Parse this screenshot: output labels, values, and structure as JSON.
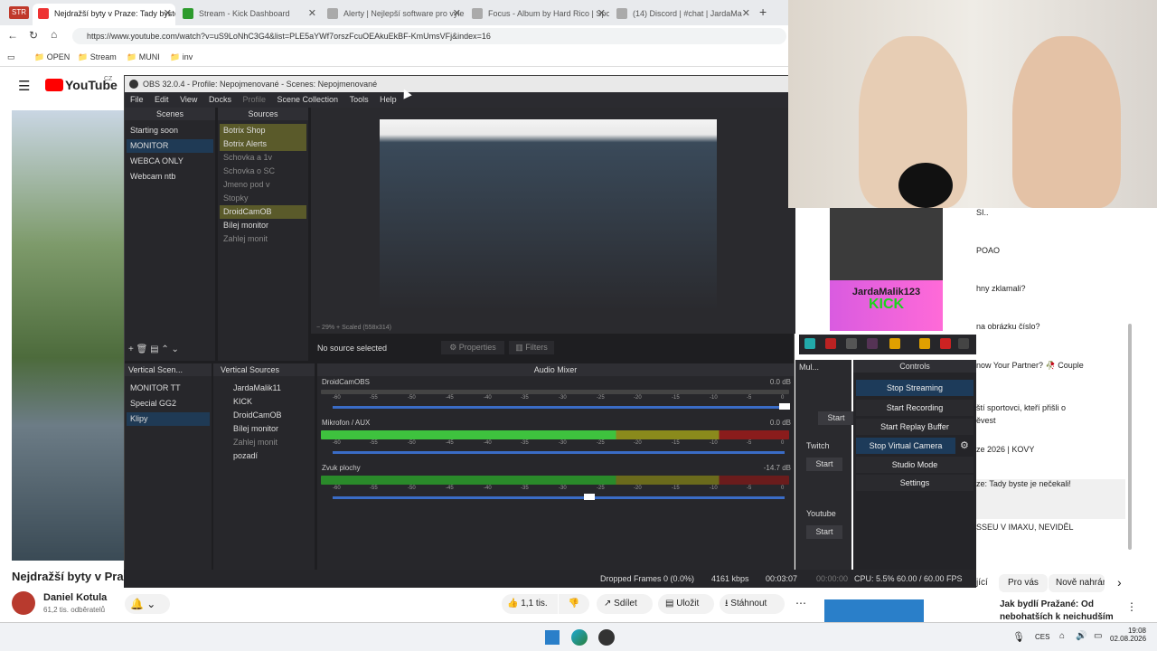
{
  "browser": {
    "str_badge": "STR",
    "tabs": [
      {
        "title": "Nejdražší byty v Praze: Tady byste",
        "fav": "#d33"
      },
      {
        "title": "Stream - Kick Dashboard",
        "fav": "#2d9b2d"
      },
      {
        "title": "Alerty | Nejlepší software pro vylep",
        "fav": "#888"
      },
      {
        "title": "Focus - Album by Hard Rico | Spot",
        "fav": "#888"
      },
      {
        "title": "(14) Discord | #chat | JardaMa",
        "fav": "#888"
      }
    ],
    "url": "https://www.youtube.com/watch?v=uS9LoNhC3G4&list=PLE5aYWf7orszFcuOEAkuEkBF-KmUmsVFj&index=16",
    "bookmarks": [
      "OPEN",
      "Stream",
      "MUNI",
      "inv"
    ]
  },
  "youtube": {
    "logo": "YouTube",
    "region": "CZ",
    "video_title": "Nejdražší byty v Praz",
    "channel": "Daniel Kotula",
    "subs": "61,2 tis. odběratelů",
    "likes": "1,1 tis.",
    "share": "Sdílet",
    "save": "Uložit",
    "download": "Stáhnout",
    "chips": [
      "Pro vás",
      "Nově nahrán"
    ],
    "chips_partial": "jící",
    "related_title_line1": "Jak bydlí Pražané: Od",
    "related_title_line2": "nebohatších k neichudším"
  },
  "obs": {
    "title": "OBS 32.0.4 - Profile: Nepojmenované - Scenes: Nepojmenované",
    "menu": [
      "File",
      "Edit",
      "View",
      "Docks",
      "Profile",
      "Scene Collection",
      "Tools",
      "Help"
    ],
    "scenes_header": "Scenes",
    "scenes": [
      "Starting soon",
      "MONITOR",
      "WEBCA ONLY",
      "Webcam ntb"
    ],
    "sources_header": "Sources",
    "sources": [
      "Botrix Shop",
      "Botrix Alerts",
      "Schovka a 1v",
      "Schovka o SC",
      "Jmeno pod v",
      "Stopky",
      "DroidCamOB",
      "Bílej monitor",
      "Zahlej monit"
    ],
    "zoom": "29%",
    "scaled": "Scaled (558x314)",
    "no_source": "No source selected",
    "properties": "Properties",
    "filters": "Filters",
    "vscenes_header": "Vertical Scen...",
    "vscenes": [
      "MONITOR TT",
      "Special GG2",
      "Klipy"
    ],
    "vsources_header": "Vertical Sources",
    "vsources": [
      "JardaMalik11",
      "KICK",
      "DroidCamOB",
      "Bílej monitor",
      "Zahlej monit",
      "pozadí"
    ],
    "mixer_header": "Audio Mixer",
    "channels": [
      {
        "name": "DroidCamOBS",
        "db": "0.0 dB"
      },
      {
        "name": "Mikrofon / AUX",
        "db": "0.0 dB"
      },
      {
        "name": "Zvuk plochy",
        "db": "-14.7 dB"
      }
    ],
    "scale": [
      "-60",
      "-55",
      "-50",
      "-45",
      "-40",
      "-35",
      "-30",
      "-25",
      "-20",
      "-15",
      "-10",
      "-5",
      "0"
    ],
    "multi_header": "Mul...",
    "multi": {
      "start1": "Start",
      "twitch": "Twitch",
      "start2": "Start",
      "youtube": "Youtube",
      "start3": "Start"
    },
    "controls_header": "Controls",
    "controls": [
      "Stop Streaming",
      "Start Recording",
      "Start Replay Buffer",
      "Stop Virtual Camera",
      "Studio Mode",
      "Settings"
    ],
    "status": {
      "dropped": "Dropped Frames 0 (0.0%)",
      "kbps": "4161 kbps",
      "live_time": "00:03:07",
      "rec_time": "00:00:00",
      "cpu": "CPU: 5.5%",
      "fps": "60.00 / 60.00 FPS"
    }
  },
  "kick": {
    "name": "JardaMalik123",
    "brand": "KICK"
  },
  "sidebar_texts": [
    "SI..",
    "POAO",
    "hny zklamali?",
    "na obrázku číslo?",
    "now Your Partner? 🥀 Couple",
    "ští sportovci, kteří přišli o",
    "ěvest",
    "ze 2026 | KOVY",
    "ze: Tady byste je nečekali!",
    "SSEU V IMAXU, NEVIDĚL"
  ],
  "taskbar": {
    "lang": "CES",
    "time": "19:08",
    "date": "02.08.2026"
  },
  "colors": {
    "obs_bg": "#1e1e21",
    "accent": "#1d3b5a",
    "meter_green": "#3ec23e"
  }
}
